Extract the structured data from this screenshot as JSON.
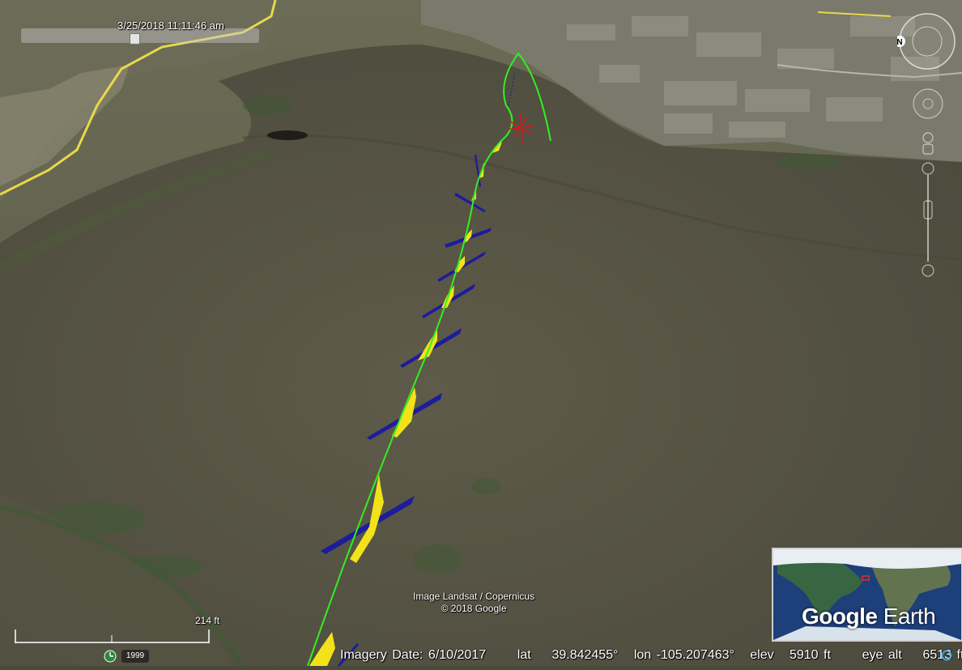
{
  "time_slider": {
    "label": "3/25/2018  11:11:46 am"
  },
  "attribution": {
    "imagery_source": "Image Landsat / Copernicus",
    "copyright": "© 2018 Google"
  },
  "scale_bar": {
    "label": "214 ft"
  },
  "historical_imagery": {
    "year": "1999"
  },
  "status_bar": {
    "imagery_date_label": "Imagery Date: 6/10/2017",
    "lat_label": "lat",
    "lat_value": "39.842455°",
    "lon_label": "lon",
    "lon_value": "-105.207463°",
    "elev_label": "elev",
    "elev_value": "5910 ft",
    "eye_alt_label": "eye alt",
    "eye_alt_value": "6513 ft"
  },
  "logo": {
    "brand": "Google",
    "product": "Earth"
  },
  "navigation": {
    "north_label": "N",
    "icons": [
      "compass-icon",
      "look-joystick-icon",
      "pegman-icon",
      "zoom-slider-icon"
    ]
  },
  "colors": {
    "flight_track": "#33ee22",
    "glider_wing": "#1c1c9c",
    "glider_body": "#f2e21a",
    "marker": "#d81818",
    "terrain": "#5a5948",
    "road": "#e8d84a"
  }
}
